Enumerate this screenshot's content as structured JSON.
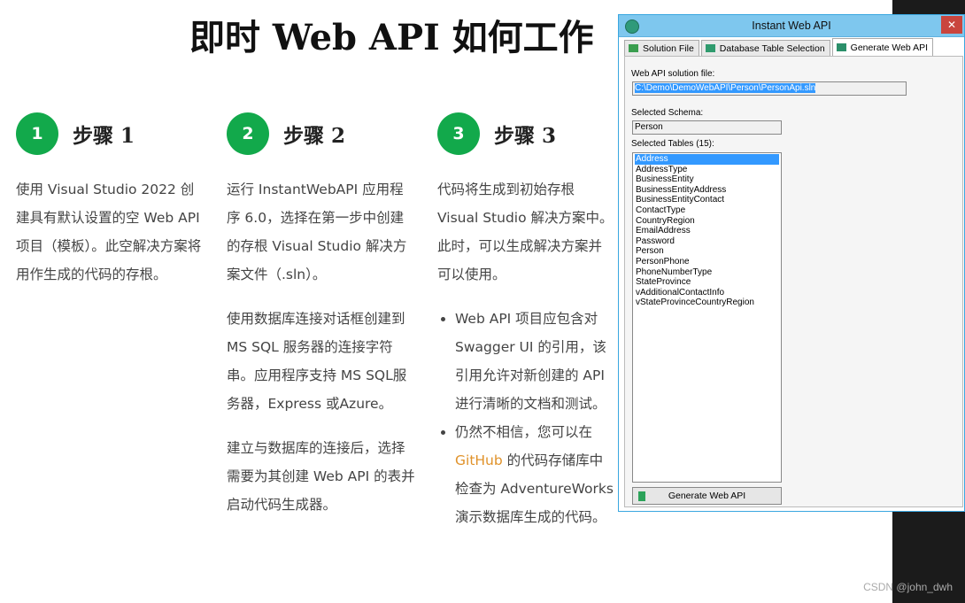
{
  "page": {
    "title": "即时 Web API 如何工作"
  },
  "steps": [
    {
      "number": "1",
      "title": "步骤 1",
      "paragraphs": [
        "使用 Visual Studio 2022 创建具有默认设置的空 Web API 项目（模板）。此空解决方案将用作生成的代码的存根。"
      ]
    },
    {
      "number": "2",
      "title": "步骤 2",
      "paragraphs": [
        "运行 InstantWebAPI 应用程序 6.0，选择在第一步中创建的存根 Visual Studio 解决方案文件（.sln）。",
        "使用数据库连接对话框创建到 MS SQL 服务器的连接字符串。应用程序支持 MS SQL服务器，Express 或Azure。",
        "建立与数据库的连接后，选择需要为其创建 Web API 的表并启动代码生成器。"
      ]
    },
    {
      "number": "3",
      "title": "步骤 3",
      "paragraphs": [
        "代码将生成到初始存根 Visual Studio 解决方案中。此时，可以生成解决方案并可以使用。"
      ],
      "bullets": {
        "b1": "Web API 项目应包含对 Swagger UI 的引用，该引用允许对新创建的 API 进行清晰的文档和测试。",
        "b2_before": "仍然不相信，您可以在 ",
        "b2_link": "GitHub",
        "b2_after": " 的代码存储库中检查为 AdventureWorks 演示数据库生成的代码。"
      }
    }
  ],
  "dialog": {
    "title": "Instant Web API",
    "tabs": [
      "Solution File",
      "Database Table Selection",
      "Generate Web API"
    ],
    "active_tab": "Generate Web API",
    "solution_label": "Web API solution file:",
    "solution_value": "C:\\Demo\\DemoWebAPI\\Person\\PersonApi.sln",
    "schema_label": "Selected Schema:",
    "schema_value": "Person",
    "tables_label": "Selected Tables (15):",
    "tables": [
      "Address",
      "AddressType",
      "BusinessEntity",
      "BusinessEntityAddress",
      "BusinessEntityContact",
      "ContactType",
      "CountryRegion",
      "EmailAddress",
      "Password",
      "Person",
      "PersonPhone",
      "PhoneNumberType",
      "StateProvince",
      "vAdditionalContactInfo",
      "vStateProvinceCountryRegion"
    ],
    "selected_table": "Address",
    "generate_label": "Generate Web API"
  },
  "watermark": "CSDN @john_dwh",
  "colors": {
    "step_badge": "#12a94b",
    "link": "#e0922a",
    "selection": "#3399ff",
    "titlebar": "#7ec7ee"
  }
}
